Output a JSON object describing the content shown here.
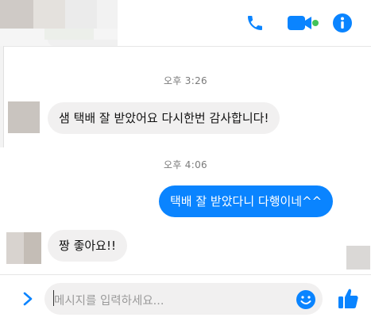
{
  "header": {
    "icons": {
      "phone": "phone-icon",
      "video": "video-icon",
      "info": "info-icon"
    },
    "accent_color": "#0a84ff"
  },
  "messages": {
    "timestamp_1": "오후 3:26",
    "msg_1": "샘 택배 잘 받았어요 다시한번 감사합니다!",
    "timestamp_2": "오후 4:06",
    "msg_2": "택배 잘 받았다니 다행이네^^",
    "msg_3": "짱 좋아요!!"
  },
  "composer": {
    "placeholder": "메시지를 입력하세요..."
  }
}
